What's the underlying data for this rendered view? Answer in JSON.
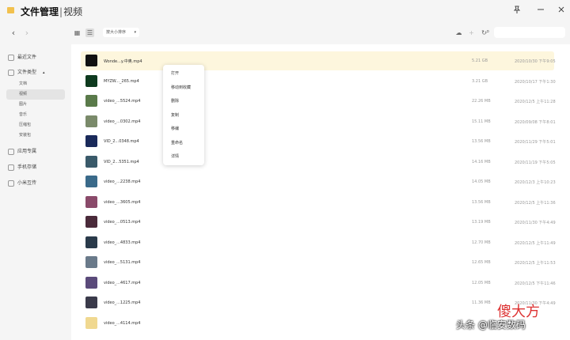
{
  "app": {
    "title": "文件管理",
    "separator": "|",
    "subtitle": "视频"
  },
  "window": {
    "pin_icon": "pin-icon",
    "minimize_icon": "minimize-icon",
    "close_icon": "close-icon"
  },
  "nav": {
    "back": "‹",
    "forward": "›"
  },
  "sidebar": {
    "recent": "最近文件",
    "types": "文件类型",
    "types_sub": [
      {
        "label": "文档"
      },
      {
        "label": "视频"
      },
      {
        "label": "图片"
      },
      {
        "label": "音乐"
      },
      {
        "label": "压缩包"
      },
      {
        "label": "安装包"
      }
    ],
    "app_folders": "应用专属",
    "phone_storage": "手机存储",
    "xiaomi_transfer": "小米互传"
  },
  "toolbar": {
    "sort_label": "按大小排序",
    "view_grid": "grid-view-icon",
    "view_list": "list-view-icon",
    "search_placeholder": ""
  },
  "files": [
    {
      "name": "Wonde...y.中奥.mp4",
      "size": "5.21 GB",
      "date": "2020/10/30 下午9:05",
      "thumb": "#111111"
    },
    {
      "name": "MYZW..._265.mp4",
      "size": "3.21 GB",
      "date": "2020/10/17 下午1:30",
      "thumb": "#0e3a1e"
    },
    {
      "name": "video_...5524.mp4",
      "size": "22.26 MB",
      "date": "2020/12/5 上午11:28",
      "thumb": "#5a7a4a"
    },
    {
      "name": "video_...0302.mp4",
      "size": "15.11 MB",
      "date": "2020/09/08 下午8:01",
      "thumb": "#7a8a6a"
    },
    {
      "name": "VID_2...0348.mp4",
      "size": "13.56 MB",
      "date": "2020/11/29 下午5:01",
      "thumb": "#1a2a5a"
    },
    {
      "name": "VID_2...5351.mp4",
      "size": "14.16 MB",
      "date": "2020/11/19 下午5:05",
      "thumb": "#3a5a6a"
    },
    {
      "name": "video_...2238.mp4",
      "size": "14.05 MB",
      "date": "2020/12/3 上午10:23",
      "thumb": "#3a6a8a"
    },
    {
      "name": "video_...3605.mp4",
      "size": "13.56 MB",
      "date": "2020/12/5 上午11:36",
      "thumb": "#8a4a6a"
    },
    {
      "name": "video_...0513.mp4",
      "size": "13.19 MB",
      "date": "2020/11/30 下午4:49",
      "thumb": "#4a2a3a"
    },
    {
      "name": "video_...4833.mp4",
      "size": "12.70 MB",
      "date": "2020/12/5 上午11:49",
      "thumb": "#2a3a4a"
    },
    {
      "name": "video_...5131.mp4",
      "size": "12.65 MB",
      "date": "2020/12/5 上午11:53",
      "thumb": "#6a7a8a"
    },
    {
      "name": "video_...4617.mp4",
      "size": "12.05 MB",
      "date": "2020/12/5 下午11:46",
      "thumb": "#5a4a7a"
    },
    {
      "name": "video_...1225.mp4",
      "size": "11.36 MB",
      "date": "2020/11/30 下午4:49",
      "thumb": "#3a3a4a"
    },
    {
      "name": "video_...4114.mp4",
      "size": "",
      "date": "",
      "thumb": "#f0d890"
    }
  ],
  "context_menu": [
    {
      "label": "打开"
    },
    {
      "label": "移动到收藏"
    },
    {
      "label": "删除"
    },
    {
      "label": "复制"
    },
    {
      "label": "移编"
    },
    {
      "label": "重命名"
    },
    {
      "label": "详情"
    }
  ],
  "watermark": {
    "big": "傻大方",
    "small": "头条 @临安数码"
  }
}
